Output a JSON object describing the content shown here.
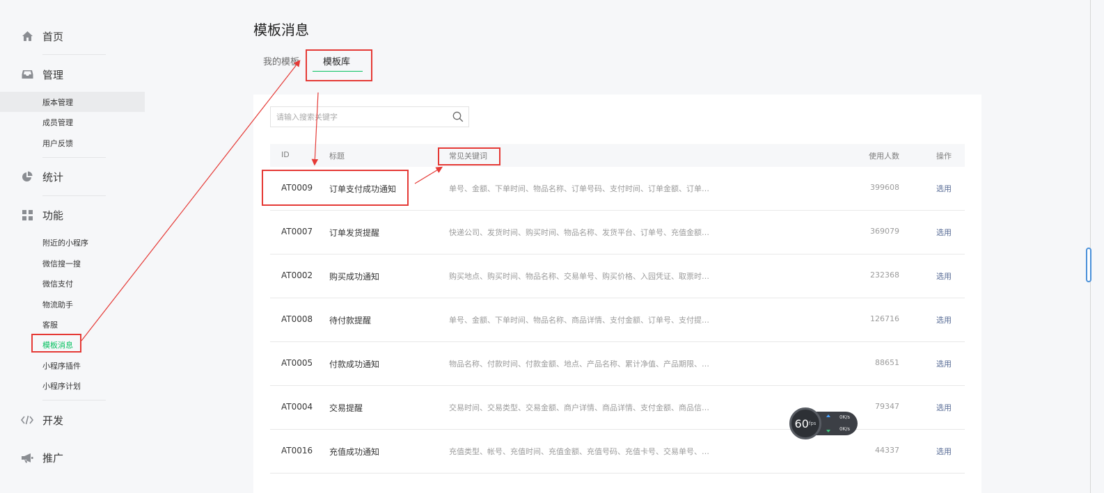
{
  "sidebar": {
    "home": "首页",
    "manage": {
      "label": "管理",
      "items": [
        "版本管理",
        "成员管理",
        "用户反馈"
      ]
    },
    "stats": "统计",
    "features": {
      "label": "功能",
      "items": [
        "附近的小程序",
        "微信搜一搜",
        "微信支付",
        "物流助手",
        "客服",
        "模板消息",
        "小程序插件",
        "小程序计划"
      ]
    },
    "dev": "开发",
    "promote": "推广"
  },
  "page": {
    "title": "模板消息",
    "tabs": {
      "mine": "我的模板",
      "library": "模板库"
    }
  },
  "search": {
    "placeholder": "请输入搜索关键字"
  },
  "table": {
    "headers": {
      "id": "ID",
      "title": "标题",
      "keywords": "常见关键词",
      "users": "使用人数",
      "op": "操作"
    },
    "rows": [
      {
        "id": "AT0009",
        "title": "订单支付成功通知",
        "keywords": "单号、金额、下单时间、物品名称、订单号码、支付时间、订单金额、订单…",
        "users": "399608",
        "op": "选用"
      },
      {
        "id": "AT0007",
        "title": "订单发货提醒",
        "keywords": "快递公司、发货时间、购买时间、物品名称、发货平台、订单号、充值金额…",
        "users": "369079",
        "op": "选用"
      },
      {
        "id": "AT0002",
        "title": "购买成功通知",
        "keywords": "购买地点、购买时间、物品名称、交易单号、购买价格、入园凭证、取票时…",
        "users": "232368",
        "op": "选用"
      },
      {
        "id": "AT0008",
        "title": "待付款提醒",
        "keywords": "单号、金额、下单时间、物品名称、商品详情、支付金额、订单号、支付提…",
        "users": "126716",
        "op": "选用"
      },
      {
        "id": "AT0005",
        "title": "付款成功通知",
        "keywords": "物品名称、付款时间、付款金额、地点、产品名称、累计净值、产品期限、…",
        "users": "88651",
        "op": "选用"
      },
      {
        "id": "AT0004",
        "title": "交易提醒",
        "keywords": "交易时间、交易类型、交易金额、商户详情、商品详情、支付金额、商品信…",
        "users": "79347",
        "op": "选用"
      },
      {
        "id": "AT0016",
        "title": "充值成功通知",
        "keywords": "充值类型、帐号、充值时间、充值金额、充值号码、充值卡号、交易单号、…",
        "users": "44337",
        "op": "选用"
      }
    ]
  },
  "fps_widget": {
    "fps": "60",
    "unit": "fps",
    "up": "0K/s",
    "down": "0K/s"
  },
  "colors": {
    "accent": "#07c160",
    "link": "#576b95",
    "annotation": "#e53935"
  },
  "icons": {
    "home": "home-icon",
    "manage": "inbox-icon",
    "stats": "pie-chart-icon",
    "features": "grid-icon",
    "dev": "code-icon",
    "promote": "megaphone-icon",
    "search": "search-icon"
  }
}
